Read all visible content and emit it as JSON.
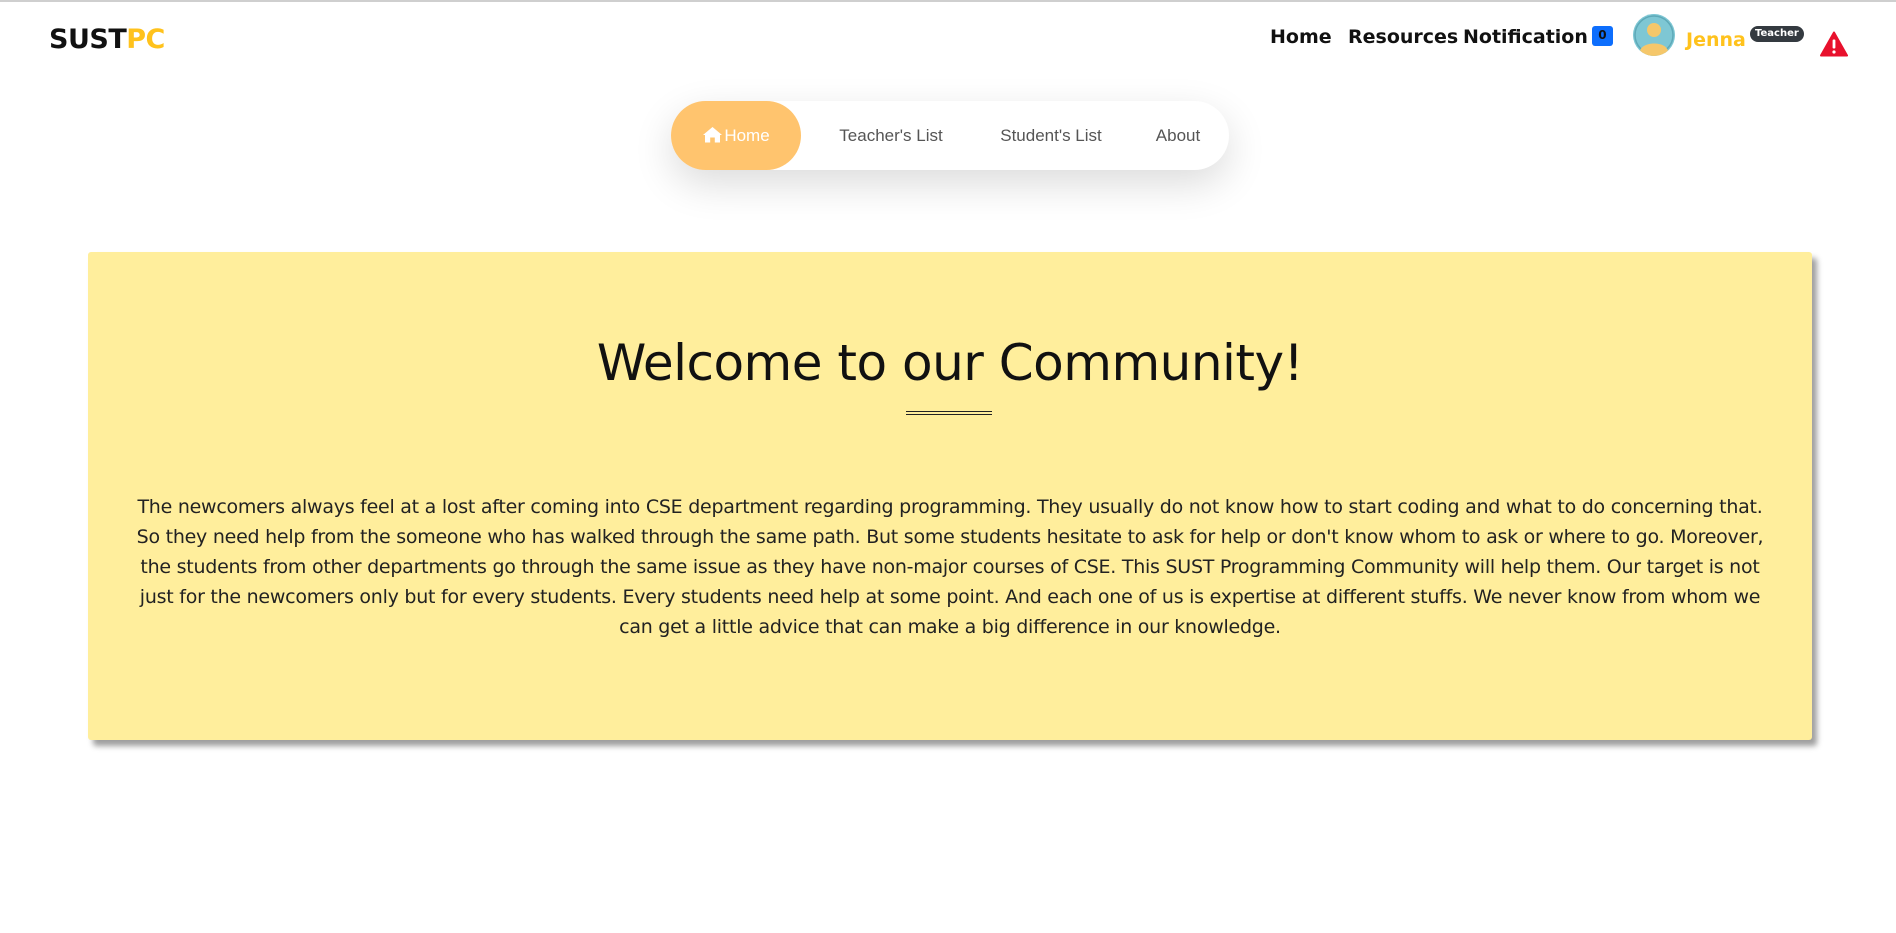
{
  "brand": {
    "part1": "SUST",
    "part2": "PC"
  },
  "topnav": {
    "home": "Home",
    "resources": "Resources",
    "notification": "Notification",
    "notification_count": "0"
  },
  "user": {
    "name": "Jenna",
    "role": "Teacher",
    "avatar_icon": "user-avatar-icon",
    "alert_icon": "warning-triangle-icon"
  },
  "tabs": [
    {
      "label": "Home",
      "icon": "home-icon",
      "active": true
    },
    {
      "label": "Teacher's List",
      "active": false
    },
    {
      "label": "Student's List",
      "active": false
    },
    {
      "label": "About",
      "active": false
    }
  ],
  "hero": {
    "title": "Welcome to our Community!",
    "body": "The newcomers always feel at a lost after coming into CSE department regarding programming. They usually do not know how to start coding and what to do concerning that. So they need help from the someone who has walked through the same path. But some students hesitate to ask for help or don't know whom to ask or where to go. Moreover, the students from other departments go through the same issue as they have non-major courses of CSE. This SUST Programming Community will help them. Our target is not just for the newcomers only but for every students. Every students need help at some point. And each one of us is expertise at different stuffs. We never know from whom we can get a little advice that can make a big difference in our knowledge."
  },
  "colors": {
    "accent": "#ffc21c",
    "active_tab": "#ffc46e",
    "hero_bg": "#ffee9c",
    "badge_blue": "#0d6efd",
    "alert_red": "#e8112d"
  }
}
